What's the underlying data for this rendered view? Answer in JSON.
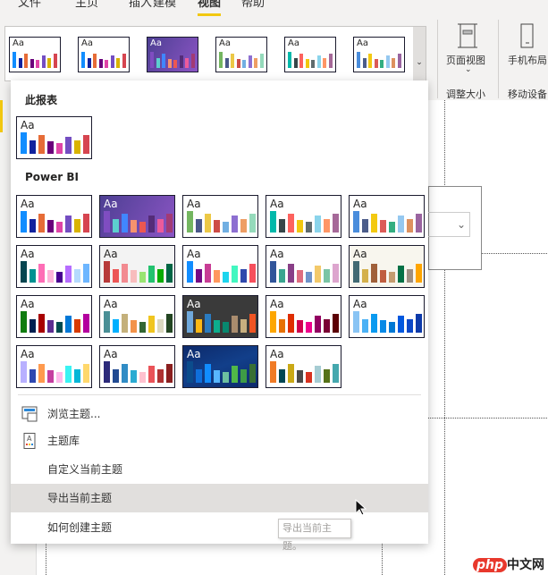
{
  "ribbon": {
    "tabs": [
      "文件",
      "主页",
      "插入",
      "建模",
      "视图",
      "帮助"
    ],
    "active_tab": "视图",
    "page_view_label": "页面视图",
    "resize_group": "调整大小",
    "phone_layout_label": "手机布局",
    "mobile_group": "移动设备",
    "accent": "#f2c811"
  },
  "themes": {
    "this_report": [
      {
        "bg": "#ffffff",
        "text": "#252423",
        "colors": [
          "#118DFF",
          "#12239E",
          "#E66C37",
          "#6B007B",
          "#E044A7",
          "#744EC2",
          "#D9B300",
          "#D64550"
        ]
      }
    ],
    "powerbi": [
      {
        "bg": "#ffffff",
        "text": "#252423",
        "colors": [
          "#118DFF",
          "#12239E",
          "#E66C37",
          "#6B007B",
          "#E044A7",
          "#744EC2",
          "#D9B300",
          "#D64550"
        ]
      },
      {
        "bg": "linear-gradient(120deg,#4d3f93,#8b55c4)",
        "text": "#ffffff",
        "colors": [
          "#7F4DC1",
          "#5CCFCF",
          "#4186FF",
          "#F6926E",
          "#EC5751",
          "#542C78",
          "#EC5B9B",
          "#A23B75"
        ]
      },
      {
        "bg": "#ffffff",
        "text": "#252423",
        "colors": [
          "#74B660",
          "#4A588A",
          "#ECC846",
          "#CD4C46",
          "#71AFE2",
          "#8D6FD1",
          "#EE9E64",
          "#95DABB"
        ]
      },
      {
        "bg": "#ffffff",
        "text": "#252423",
        "colors": [
          "#01B8AA",
          "#374649",
          "#FD625E",
          "#F2C80F",
          "#5F6B6D",
          "#8AD4EB",
          "#FE9666",
          "#A66999"
        ]
      },
      {
        "bg": "#ffffff",
        "text": "#252423",
        "colors": [
          "#4A8DDC",
          "#4C5D8A",
          "#F3C911",
          "#DC5B57",
          "#33AE81",
          "#95C8F0",
          "#DD915F",
          "#9A64A0"
        ]
      },
      {
        "bg": "#ffffff",
        "text": "#252423",
        "colors": [
          "#074650",
          "#009292",
          "#FE6DB6",
          "#FEB5DA",
          "#480091",
          "#B66DFF",
          "#B5DAFE",
          "#6DB6FF"
        ]
      },
      {
        "bg": "#f3f3f3",
        "text": "#252423",
        "colors": [
          "#B73A3A",
          "#EC5656",
          "#F28A90",
          "#F8BCBD",
          "#99E472",
          "#23C26F",
          "#0AAC00",
          "#026645"
        ]
      },
      {
        "bg": "#ffffff",
        "text": "#252423",
        "colors": [
          "#118DFF",
          "#750985",
          "#C83D95",
          "#FF985E",
          "#1DD5EE",
          "#42F7C0",
          "#3049AD",
          "#F64F5C"
        ]
      },
      {
        "bg": "#ffffff",
        "text": "#252423",
        "colors": [
          "#31559A",
          "#3AA590",
          "#893F87",
          "#DF6D7F",
          "#6F93CA",
          "#F3C96A",
          "#7AC4A5",
          "#DDA5CE"
        ]
      },
      {
        "bg": "#f8f6ee",
        "text": "#252423",
        "colors": [
          "#426A73",
          "#D4B04B",
          "#A0603A",
          "#C05D3F",
          "#C59C6F",
          "#057146",
          "#9E8F83",
          "#FFA500"
        ]
      },
      {
        "bg": "#ffffff",
        "text": "#252423",
        "colors": [
          "#107C10",
          "#002050",
          "#A80000",
          "#5C2D91",
          "#004B50",
          "#0078D7",
          "#D83B01",
          "#B4009E"
        ]
      },
      {
        "bg": "#ffffff",
        "text": "#252423",
        "colors": [
          "#4A8F96",
          "#00B0FF",
          "#C4B07B",
          "#F3934A",
          "#336633",
          "#F0C51F",
          "#DBD8C0",
          "#234522"
        ]
      },
      {
        "bg": "#3a3a3a",
        "text": "#ffffff",
        "colors": [
          "#6FA8DC",
          "#FDB813",
          "#2A7BC0",
          "#0DAD8D",
          "#08876F",
          "#A98C6E",
          "#C8AF7F",
          "#F05423"
        ]
      },
      {
        "bg": "#ffffff",
        "text": "#252423",
        "colors": [
          "#FDA600",
          "#E77102",
          "#DF2E02",
          "#D0004F",
          "#EE008C",
          "#920061",
          "#7A0034",
          "#5C0005"
        ]
      },
      {
        "bg": "#ffffff",
        "text": "#252423",
        "colors": [
          "#89C4F4",
          "#4BB1F5",
          "#0A9AF0",
          "#0789E6",
          "#0078D4",
          "#0258DF",
          "#0B47C7",
          "#0D3AAA"
        ]
      },
      {
        "bg": "#ffffff",
        "text": "#252423",
        "colors": [
          "#B8B0FF",
          "#2E48B0",
          "#FF9A4E",
          "#C53EA0",
          "#FFBAEC",
          "#3AF3F3",
          "#04B6D7",
          "#FFD86C"
        ]
      },
      {
        "bg": "#ffffff",
        "text": "#252423",
        "colors": [
          "#2C2A7A",
          "#224B92",
          "#308CC5",
          "#2BABD2",
          "#FFC1CF",
          "#EA5358",
          "#AF3232",
          "#8B1F1F"
        ]
      },
      {
        "bg": "linear-gradient(160deg,#0d2a6b,#123f8a 50%,#0d2a6b)",
        "text": "#ffffff",
        "colors": [
          "#0B4C8C",
          "#0F6FDB",
          "#118DFF",
          "#58B7FF",
          "#6DBFA0",
          "#51B848",
          "#3E9B46",
          "#386F34"
        ]
      },
      {
        "bg": "#ffffff",
        "text": "#252423",
        "colors": [
          "#F07B26",
          "#004753",
          "#CAA916",
          "#4A4A4A",
          "#D73220",
          "#A6CCD3",
          "#567219",
          "#45A8AE"
        ]
      }
    ],
    "gallery_indices": [
      0,
      0,
      1,
      2,
      3,
      4
    ],
    "sample_text": "Aa",
    "bar_levels": [
      1,
      0.62,
      0.88,
      0.58,
      0.5,
      0.79,
      0.62,
      0.88
    ]
  },
  "panel": {
    "this_report_header": "此报表",
    "powerbi_header": "Power BI",
    "menu": [
      {
        "label": "浏览主题...",
        "icon": "browse-icon"
      },
      {
        "label": "主题库",
        "icon": "gallery-icon"
      },
      {
        "label": "自定义当前主题"
      },
      {
        "label": "导出当前主题",
        "highlighted": true
      },
      {
        "label": "如何创建主题"
      }
    ]
  },
  "tooltip": "导出当前主题。",
  "watermark": "php中文网"
}
